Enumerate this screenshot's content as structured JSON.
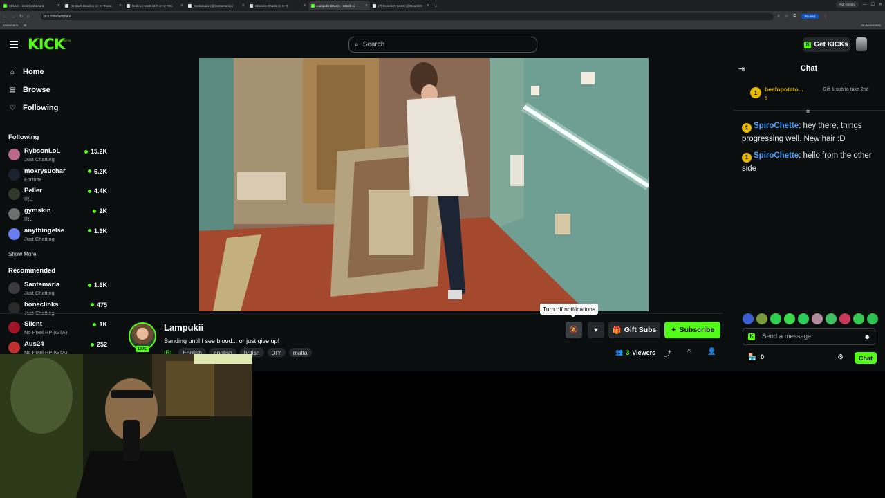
{
  "browser": {
    "tabs": [
      {
        "title": "Stream - Kick Dashboard",
        "active": false
      },
      {
        "title": "(5) Zach Beasley on X: \"Facin",
        "active": false
      },
      {
        "title": "Roblox | LIVE 24/7 on X: \"We",
        "active": false
      },
      {
        "title": "Santamaria (@Santamaria) /",
        "active": false
      },
      {
        "title": "Streams Charts on X: \"(",
        "active": false
      },
      {
        "title": "Lampukii Stream - Watch Li",
        "active": true
      },
      {
        "title": "(7) Boards N BASS (@BoardsN",
        "active": false
      }
    ],
    "new_tab": "+",
    "ask_label": "Ask Gemini",
    "url": "kick.com/lampukii",
    "paused_label": "Paused",
    "bookmark_items": [
      "santamaria",
      "⊞"
    ],
    "all_bookmarks": "All Bookmarks"
  },
  "header": {
    "logo": "KICK",
    "logo_beta": "BETA",
    "search_placeholder": "Search",
    "get_kicks": "Get KICKs"
  },
  "sidebar": {
    "nav": [
      {
        "label": "Home",
        "icon": "home-icon"
      },
      {
        "label": "Browse",
        "icon": "browse-icon"
      },
      {
        "label": "Following",
        "icon": "heart-icon"
      }
    ],
    "following_title": "Following",
    "following": [
      {
        "name": "RybsonLoL",
        "category": "Just Chatting",
        "viewers": "15.2K",
        "color": "#b96a8c"
      },
      {
        "name": "mokrysuchar",
        "category": "Fortnite",
        "viewers": "6.2K",
        "color": "#1b2230"
      },
      {
        "name": "Peller",
        "category": "IRL",
        "viewers": "4.4K",
        "color": "#2f3a2a"
      },
      {
        "name": "gymskin",
        "category": "IRL",
        "viewers": "2K",
        "color": "#6f6f6f"
      },
      {
        "name": "anythingelse",
        "category": "Just Chatting",
        "viewers": "1.9K",
        "color": "#6a7cf0"
      }
    ],
    "show_more": "Show More",
    "recommended_title": "Recommended",
    "recommended": [
      {
        "name": "Santamaria",
        "category": "Just Chatting",
        "viewers": "1.6K",
        "color": "#3b3b3b"
      },
      {
        "name": "boneclinks",
        "category": "Just Chatting",
        "viewers": "475",
        "color": "#2a2a2a"
      },
      {
        "name": "Silent",
        "category": "No Pixel RP (GTA)",
        "viewers": "1K",
        "color": "#a01428"
      },
      {
        "name": "Aus24",
        "category": "No Pixel RP (GTA)",
        "viewers": "252",
        "color": "#c03030"
      }
    ]
  },
  "stream": {
    "name": "Lampukii",
    "title": "Sanding until I see blood... or just give up!",
    "live": "LIVE",
    "category": "IRL",
    "tags": [
      "English",
      "english",
      "british",
      "DIY",
      "malta"
    ],
    "viewers_count": "3",
    "viewers_label": "Viewers",
    "tooltip": "Turn off notifications",
    "gift_subs": "Gift Subs",
    "subscribe": "Subscribe"
  },
  "chat": {
    "title": "Chat",
    "pinned": {
      "name": "beefnpotato...",
      "count": "5",
      "rank": "1",
      "message": "Gift 1 sub to take 2nd"
    },
    "messages": [
      {
        "badge": "1",
        "user": "SpiroChette",
        "text": ": hey there, things progressing well. New hair :D"
      },
      {
        "badge": "1",
        "user": "SpiroChette",
        "text": ": hello from the other side"
      }
    ],
    "input_placeholder": "Send a message",
    "store_count": "0",
    "chat_button": "Chat"
  },
  "colors": {
    "accent": "#53fc18",
    "background": "#0b0e0f",
    "username": "#4aa0ff",
    "gifter": "#e6b800"
  }
}
